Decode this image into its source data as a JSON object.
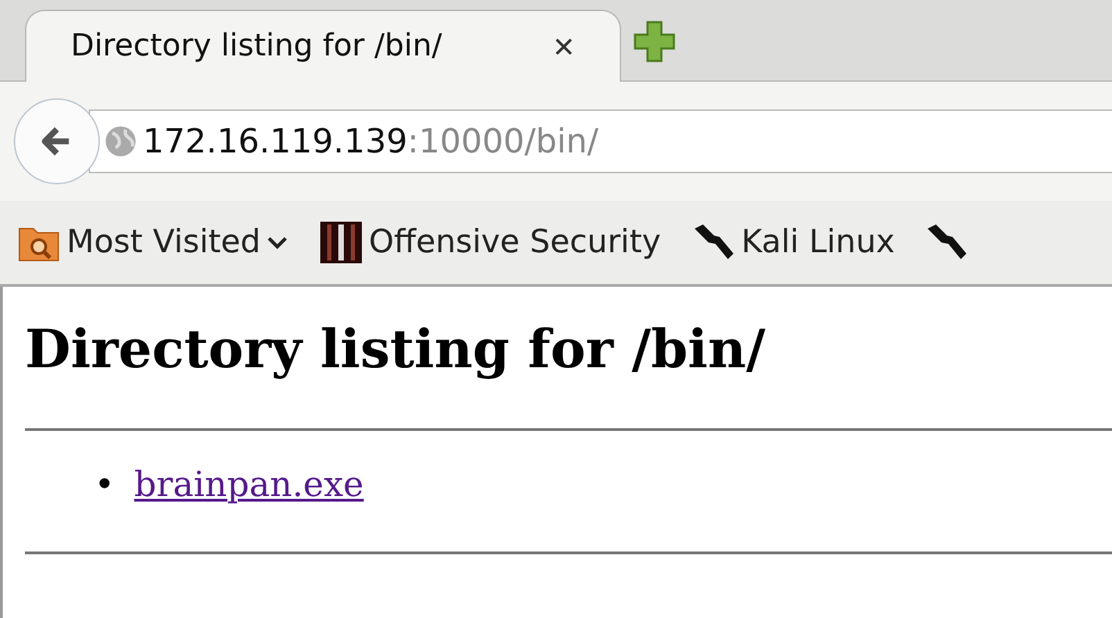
{
  "tabs": [
    {
      "title": "Directory listing for /bin/",
      "selected": true,
      "close": "✕"
    }
  ],
  "address": {
    "host": "172.16.119.139",
    "rest": ":10000/bin/"
  },
  "bookmarks": [
    {
      "kind": "folder",
      "label": "Most Visited",
      "dropdown": true
    },
    {
      "kind": "offsec",
      "label": "Offensive Security",
      "dropdown": false
    },
    {
      "kind": "kali",
      "label": "Kali Linux",
      "dropdown": false
    },
    {
      "kind": "kali",
      "dropdown": false
    }
  ],
  "page": {
    "heading": "Directory listing for /bin/",
    "links": [
      {
        "marker": "•",
        "text": "brainpan.exe",
        "visited": true
      }
    ]
  }
}
